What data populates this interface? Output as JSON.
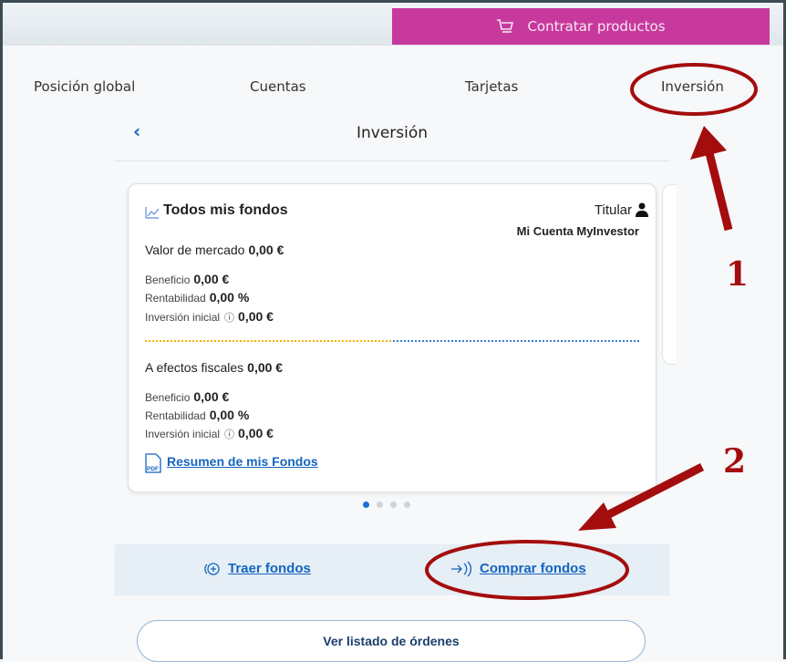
{
  "header": {
    "contract_label": "Contratar productos"
  },
  "nav": {
    "tabs": [
      "Posición global",
      "Cuentas",
      "Tarjetas",
      "Inversión"
    ]
  },
  "page": {
    "title": "Inversión"
  },
  "card": {
    "title": "Todos mis fondos",
    "holder_label": "Titular",
    "account_name": "Mi Cuenta MyInvestor",
    "market": {
      "label": "Valor de mercado",
      "value": "0,00 €"
    },
    "market_rows": [
      {
        "label": "Beneficio",
        "value": "0,00 €"
      },
      {
        "label": "Rentabilidad",
        "value": "0,00 %"
      },
      {
        "label": "Inversión inicial",
        "value": "0,00 €"
      }
    ],
    "fiscal": {
      "label": "A efectos fiscales",
      "value": "0,00 €"
    },
    "fiscal_rows": [
      {
        "label": "Beneficio",
        "value": "0,00 €"
      },
      {
        "label": "Rentabilidad",
        "value": "0,00 %"
      },
      {
        "label": "Inversión inicial",
        "value": "0,00 €"
      }
    ],
    "pdf_link": "Resumen de mis Fondos",
    "pdf_icon_text": "PDF"
  },
  "carousel": {
    "count": 4,
    "active": 0
  },
  "actions": {
    "bring": "Traer fondos",
    "buy": "Comprar fondos"
  },
  "orders_button": "Ver listado de órdenes",
  "annotations": {
    "mark1": "1",
    "mark2": "2",
    "color": "#a40d0d"
  }
}
